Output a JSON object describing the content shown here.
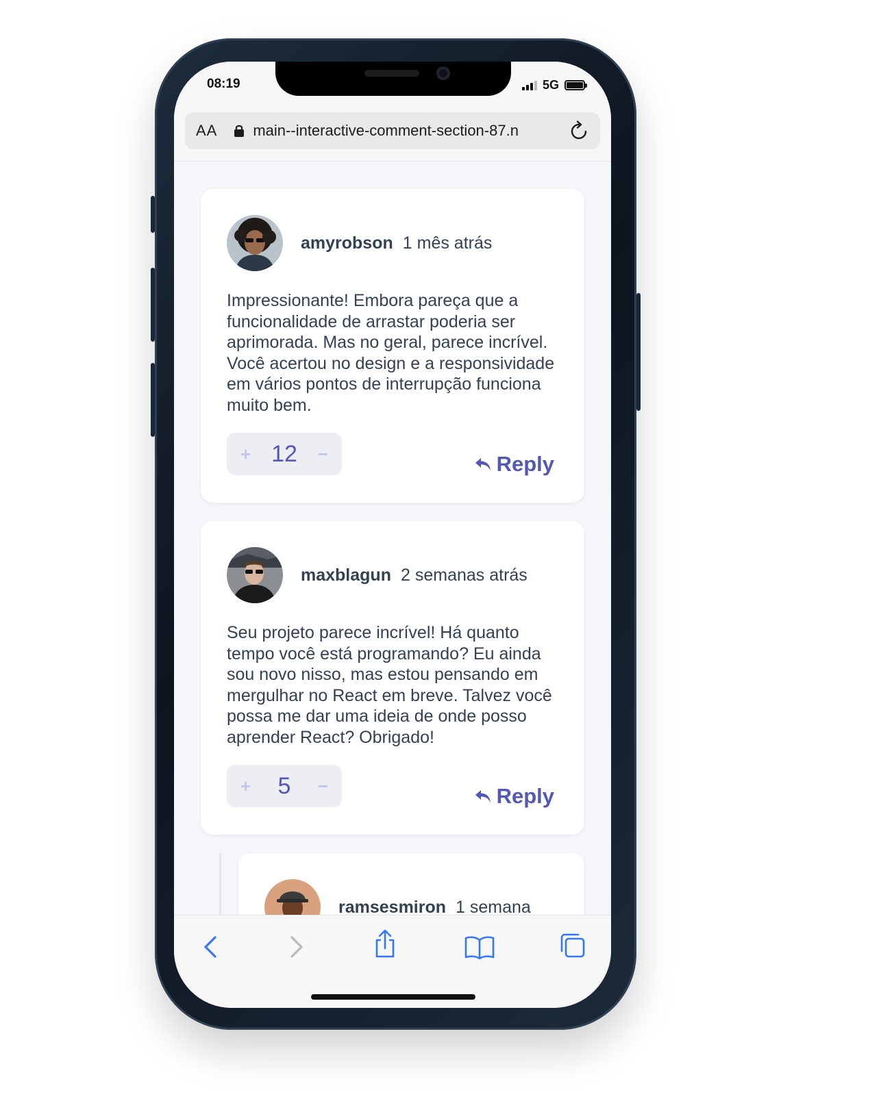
{
  "status": {
    "time": "08:19",
    "network": "5G"
  },
  "browser": {
    "text_size_label": "AA",
    "url": "main--interactive-comment-section-87.n"
  },
  "comments": [
    {
      "username": "amyrobson",
      "time": "1 mês atrás",
      "text": "Impressionante! Embora pareça que a funcionalidade de arrastar poderia ser aprimorada. Mas no geral, parece incrível. Você acertou no design e a responsividade em vários pontos de interrupção funciona muito bem.",
      "score": "12",
      "reply_label": "Reply"
    },
    {
      "username": "maxblagun",
      "time": "2 semanas atrás",
      "text": "Seu projeto parece incrível! Há quanto tempo você está programando? Eu ainda sou novo nisso, mas estou pensando em mergulhar no React em breve. Talvez você possa me dar uma ideia de onde posso aprender React? Obrigado!",
      "score": "5",
      "reply_label": "Reply"
    },
    {
      "username": "ramsesmiron",
      "time": "1 semana"
    }
  ],
  "vote": {
    "plus": "+",
    "minus": "−"
  },
  "colors": {
    "accent": "#5357b6",
    "text": "#334253",
    "vote_bg": "#eceef4",
    "page_bg": "#f5f6fa"
  },
  "icons": [
    "lock-icon",
    "reload-icon",
    "reply-icon",
    "back-icon",
    "forward-icon",
    "share-icon",
    "bookmarks-icon",
    "tabs-icon"
  ]
}
